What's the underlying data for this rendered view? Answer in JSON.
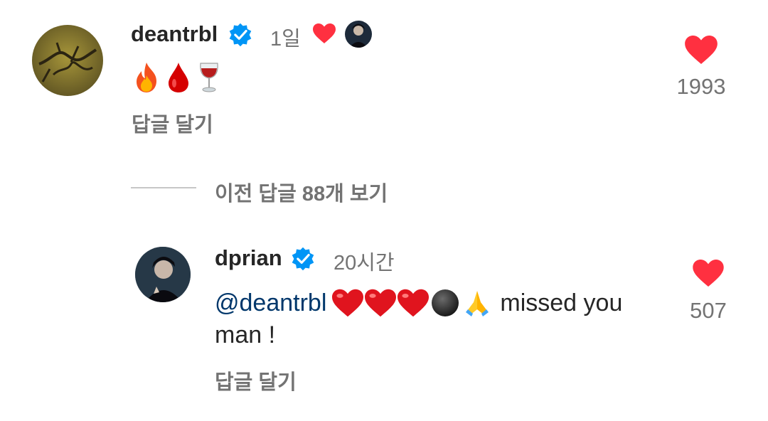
{
  "comment": {
    "username": "deantrbl",
    "time": "1일",
    "emoji_labels": [
      "fire",
      "drop-of-blood",
      "wine-glass"
    ],
    "reply_label": "답글 달기",
    "like_count": "1993"
  },
  "view_replies": {
    "label": "이전 답글 88개 보기"
  },
  "reply": {
    "username": "dprian",
    "time": "20시간",
    "mention": "@deantrbl",
    "text_tail": "missed you",
    "text_line2": "man !",
    "reply_label": "답글 달기",
    "like_count": "507"
  },
  "colors": {
    "like_red": "#ff3040",
    "verified_blue": "#0095f6",
    "mention_blue": "#00376b",
    "secondary_text": "#737373"
  }
}
